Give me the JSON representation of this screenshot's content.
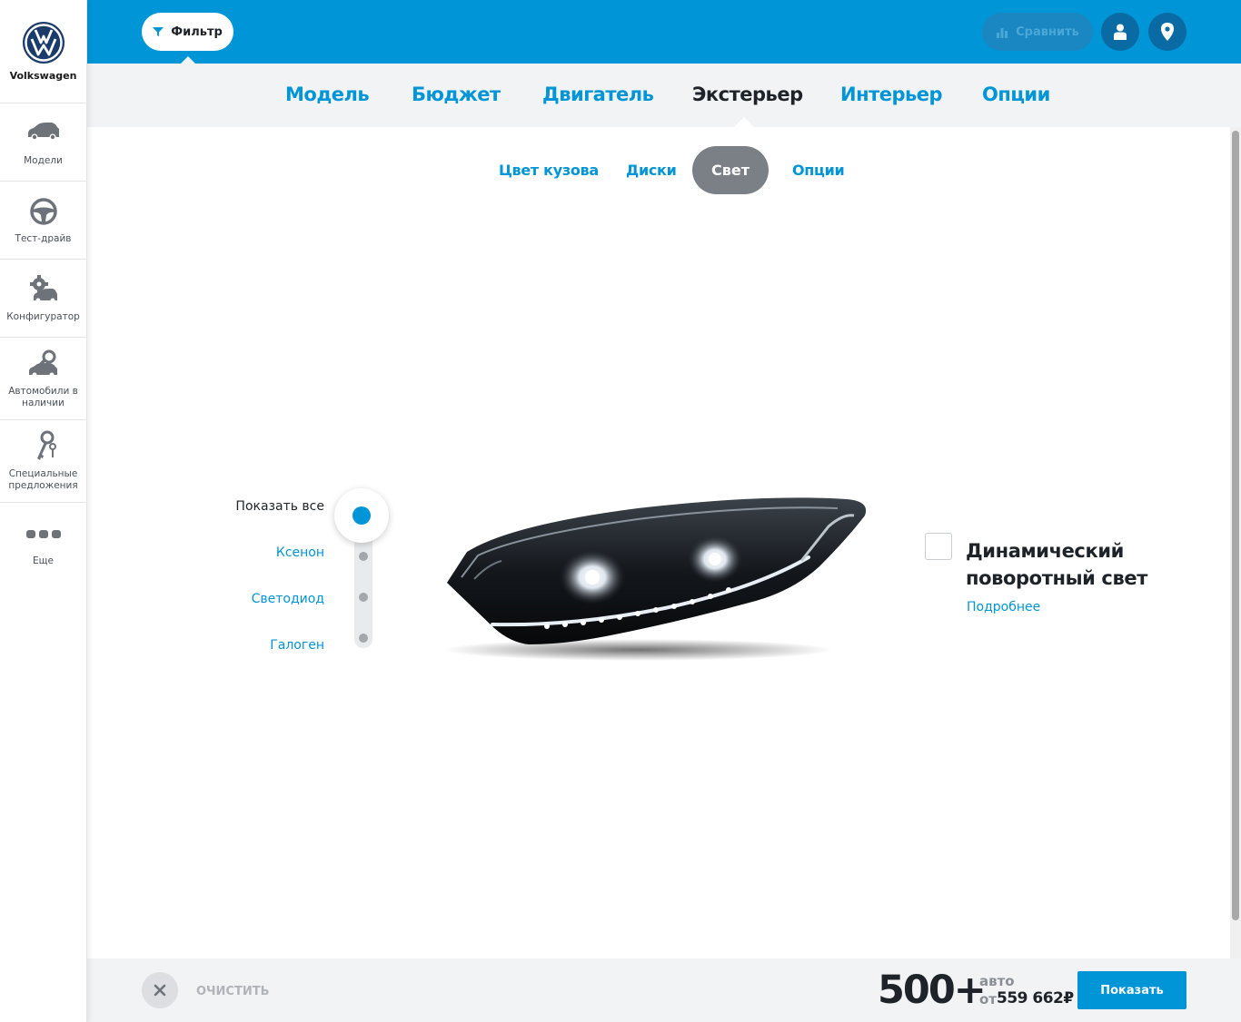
{
  "brand": {
    "name": "Volkswagen",
    "logo_icon": "vw-logo"
  },
  "sidebar": {
    "items": [
      {
        "label": "Модели",
        "icon": "car-icon"
      },
      {
        "label": "Тест-драйв",
        "icon": "steering-wheel-icon"
      },
      {
        "label": "Конфигуратор",
        "icon": "gear-car-icon"
      },
      {
        "label": "Автомобили в наличии",
        "icon": "car-search-icon"
      },
      {
        "label": "Специальные предложения",
        "icon": "keys-icon"
      },
      {
        "label": "Еще",
        "icon": "more-dots-icon"
      }
    ]
  },
  "header": {
    "filter_label": "Фильтр",
    "compare_label": "Сравнить",
    "user_icon": "user-icon",
    "location_icon": "location-pin-icon"
  },
  "tabs": [
    "Модель",
    "Бюджет",
    "Двигатель",
    "Экстерьер",
    "Интерьер",
    "Опции"
  ],
  "active_tab": "Экстерьер",
  "subtabs": [
    "Цвет кузова",
    "Диски",
    "Свет",
    "Опции"
  ],
  "active_subtab": "Свет",
  "light_filter": {
    "options": [
      "Показать все",
      "Ксенон",
      "Светодиод",
      "Галоген"
    ],
    "selected": "Показать все"
  },
  "feature": {
    "title": "Динамический поворотный свет",
    "more_link": "Подробнее",
    "checked": false
  },
  "footer": {
    "clear_label": "ОЧИСТИТЬ",
    "count": "500+",
    "unit": "авто",
    "price_prefix": "от",
    "price": "559 662",
    "currency": "₽",
    "show_label": "Показать"
  },
  "colors": {
    "primary": "#0095d6",
    "dark_text": "#1d2328",
    "active_pill": "#7b8087",
    "panel": "#f2f3f5"
  }
}
